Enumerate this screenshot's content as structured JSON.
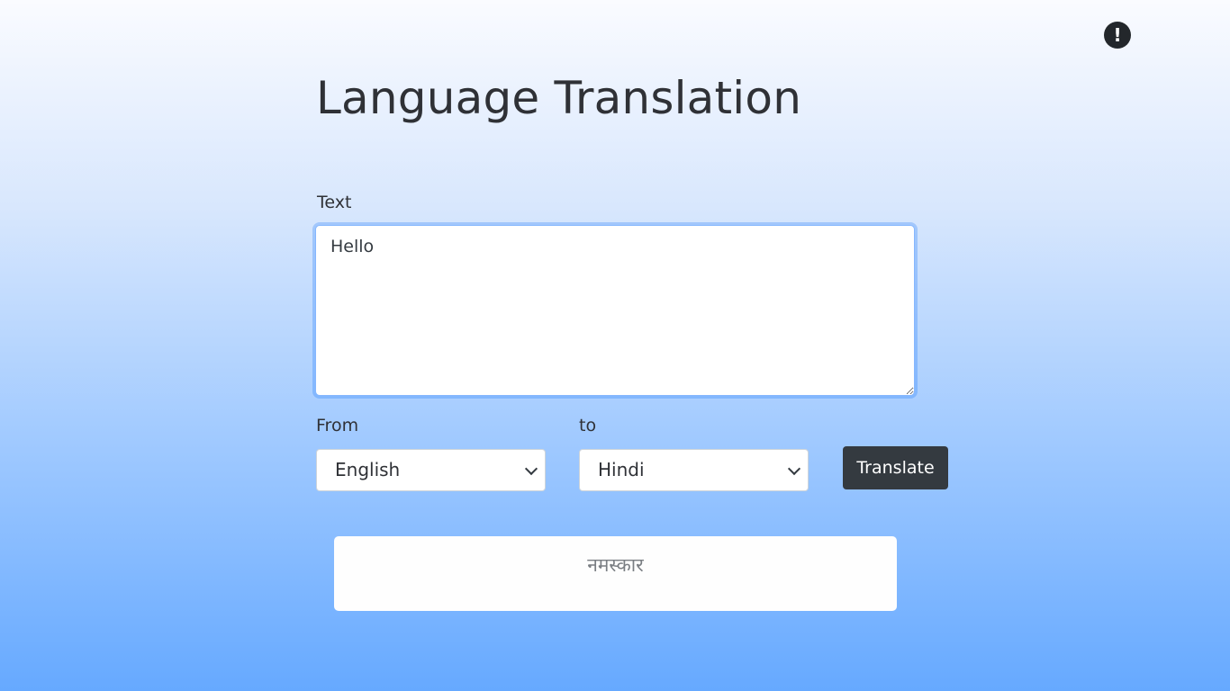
{
  "header": {
    "title": "Language Translation",
    "alert_icon": "exclamation-circle-icon",
    "alert_glyph": "!"
  },
  "form": {
    "text_label": "Text",
    "text_value": "Hello",
    "from_label": "From",
    "from_selected": "English",
    "to_label": "to",
    "to_selected": "Hindi",
    "translate_label": "Translate"
  },
  "result": {
    "text": "नमस्कार"
  },
  "colors": {
    "button_bg": "#343a40",
    "focus_ring": "#86b7fe",
    "gradient_top": "#fafbff",
    "gradient_bottom": "#66a9ff"
  }
}
